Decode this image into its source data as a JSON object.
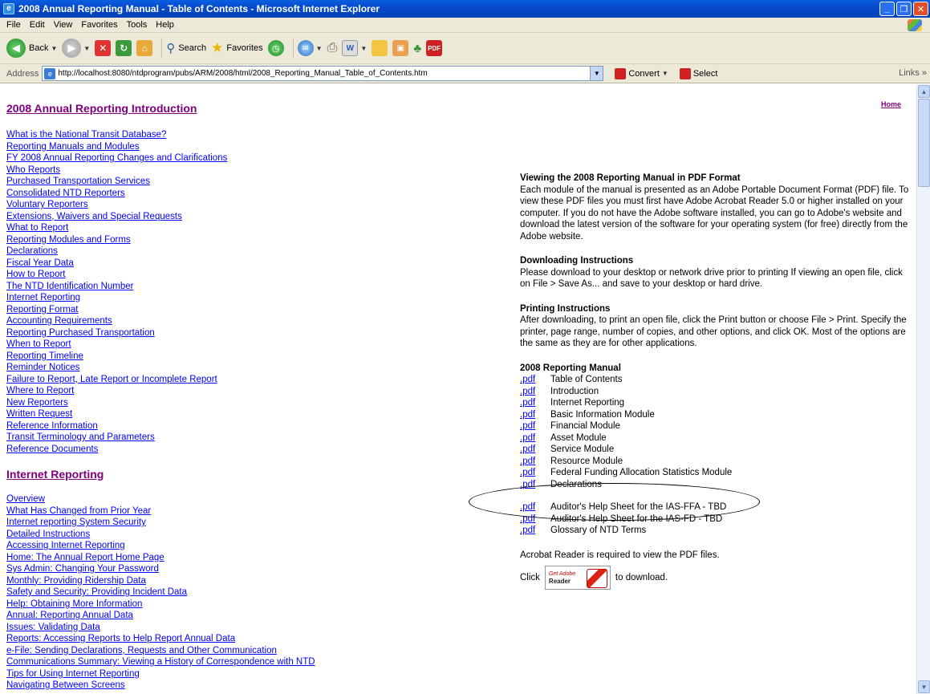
{
  "window": {
    "title": "2008 Annual Reporting Manual - Table of Contents - Microsoft Internet Explorer"
  },
  "menu": [
    "File",
    "Edit",
    "View",
    "Favorites",
    "Tools",
    "Help"
  ],
  "toolbar": {
    "back": "Back",
    "search": "Search",
    "favorites": "Favorites"
  },
  "addressbar": {
    "label": "Address",
    "url": "http://localhost:8080/ntdprogram/pubs/ARM/2008/html/2008_Reporting_Manual_Table_of_Contents.htm",
    "convert": "Convert",
    "select": "Select",
    "links": "Links"
  },
  "page": {
    "home": "Home",
    "intro_title": "2008 Annual Reporting Introduction",
    "intro_links": [
      "What is the National Transit Database?",
      "Reporting Manuals and Modules",
      "FY 2008 Annual Reporting Changes and Clarifications",
      "Who Reports",
      "Purchased Transportation Services",
      "Consolidated NTD Reporters",
      "Voluntary Reporters",
      "Extensions, Waivers and Special Requests",
      "What to Report",
      "Reporting Modules and Forms",
      "Declarations",
      "Fiscal Year Data",
      "How to Report",
      "The NTD Identification Number",
      "Internet Reporting",
      "Reporting Format",
      "Accounting Requirements",
      "Reporting Purchased Transportation",
      "When to Report",
      "Reporting Timeline",
      "Reminder Notices",
      "Failure to Report, Late Report or Incomplete Report",
      "Where to Report",
      "New Reporters",
      "Written Request",
      "Reference Information",
      "Transit Terminology and Parameters",
      "Reference Documents"
    ],
    "internet_title": "Internet Reporting",
    "internet_links": [
      "Overview",
      "What Has Changed from Prior Year",
      "Internet reporting System Security",
      "Detailed Instructions",
      "Accessing Internet Reporting",
      "Home: The Annual Report Home Page",
      "Sys Admin: Changing Your Password",
      "Monthly: Providing Ridership Data",
      "Safety and Security: Providing Incident Data",
      "Help: Obtaining More Information",
      "Annual: Reporting Annual Data",
      "Issues: Validating Data",
      "Reports: Accessing Reports to Help Report Annual Data",
      "e-File: Sending Declarations, Requests and Other Communication",
      "Communications Summary: Viewing a History of Correspondence with NTD",
      "Tips for Using Internet Reporting",
      "Navigating Between Screens"
    ],
    "pdf_view_title": "Viewing the 2008 Reporting Manual in PDF Format",
    "pdf_view_text": "Each module of the manual is presented as an Adobe Portable Document Format (PDF) file. To view these PDF files you must first have Adobe Acrobat Reader 5.0 or higher installed on your computer. If you do not have the Adobe software installed, you can go to Adobe's website and download the latest version of the software for your operating system (for free) directly from the Adobe website.",
    "download_title": "Downloading Instructions",
    "download_text": "Please download to your desktop or network drive prior to printing If viewing an open file, click on File > Save As... and save to your desktop or hard drive.",
    "print_title": "Printing Instructions",
    "print_text": "After downloading, to print an open file, click the Print button or choose File > Print. Specify the printer, page range, number of copies, and other options, and click OK. Most of the options are the same as they are for other applications.",
    "manual_title": "2008 Reporting Manual",
    "pdf_link_label": ".pdf",
    "manual_items": [
      "Table of Contents",
      "Introduction",
      "Internet Reporting",
      "Basic Information Module",
      "Financial Module",
      "Asset Module",
      "Service Module",
      "Resource Module",
      "Federal Funding Allocation Statistics Module",
      "Declarations"
    ],
    "extra_items": [
      "Auditor's Help Sheet for the IAS-FFA - TBD",
      "Auditor's Help Sheet for the IAS-FD - TBD",
      "Glossary of NTD Terms"
    ],
    "acrobat_required": "Acrobat Reader is required to view the PDF files.",
    "click": "Click",
    "to_download": "to download.",
    "adobe_get": "Get Adobe",
    "adobe_reader": "Reader"
  }
}
